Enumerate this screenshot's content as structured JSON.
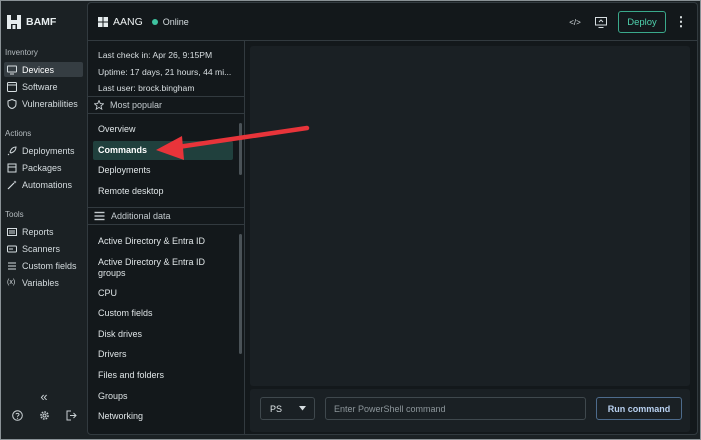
{
  "brand": {
    "name": "BAMF"
  },
  "sidebar": {
    "sections": [
      {
        "label": "Inventory",
        "items": [
          {
            "label": "Devices",
            "icon": "monitor-icon",
            "active": true
          },
          {
            "label": "Software",
            "icon": "software-icon"
          },
          {
            "label": "Vulnerabilities",
            "icon": "shield-icon"
          }
        ]
      },
      {
        "label": "Actions",
        "items": [
          {
            "label": "Deployments",
            "icon": "rocket-icon"
          },
          {
            "label": "Packages",
            "icon": "package-icon"
          },
          {
            "label": "Automations",
            "icon": "wand-icon"
          }
        ]
      },
      {
        "label": "Tools",
        "items": [
          {
            "label": "Reports",
            "icon": "list-icon"
          },
          {
            "label": "Scanners",
            "icon": "scanner-icon"
          },
          {
            "label": "Custom fields",
            "icon": "fields-icon"
          },
          {
            "label": "Variables",
            "icon": "variables-icon"
          }
        ]
      }
    ],
    "variables_glyph": "(x)",
    "collapse_glyph": "«"
  },
  "device": {
    "name": "AANG",
    "status": "Online",
    "info": [
      "Last check in: Apr 26, 9:15PM",
      "Uptime: 17 days, 21 hours, 44 mi...",
      "Last user: brock.bingham"
    ]
  },
  "toolbar": {
    "deploy_label": "Deploy",
    "code_glyph": "</>",
    "more_glyph": "⋮"
  },
  "groups": {
    "popular": {
      "label": "Most popular",
      "items": [
        "Overview",
        "Commands",
        "Deployments",
        "Remote desktop"
      ],
      "selected": "Commands"
    },
    "additional": {
      "label": "Additional data",
      "items": [
        "Active Directory & Entra ID",
        "Active Directory & Entra ID groups",
        "CPU",
        "Custom fields",
        "Disk drives",
        "Drivers",
        "Files and folders",
        "Groups",
        "Networking"
      ]
    }
  },
  "command": {
    "shell": "PS",
    "placeholder": "Enter PowerShell command",
    "run_label": "Run command"
  },
  "colors": {
    "accent": "#3ec3a0",
    "selected_bg": "#20403d",
    "annotation_arrow": "#e8343a"
  }
}
